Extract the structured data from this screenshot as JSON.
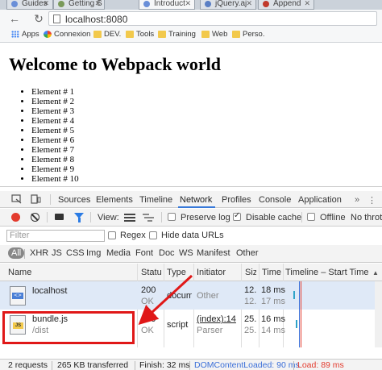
{
  "browser": {
    "tabs": [
      {
        "label": "Guides",
        "color": "#6a8fd8"
      },
      {
        "label": "Getting S",
        "color": "#7a9a5a"
      },
      {
        "label": "Introduct",
        "color": "#6a8fd8"
      },
      {
        "label": "jQuery.aj",
        "color": "#5a7fc4"
      },
      {
        "label": "Append",
        "color": "#c0392b"
      }
    ],
    "url": "localhost:8080",
    "bookmarks": [
      "Apps",
      "Connexion",
      "DEV.",
      "Tools",
      "Training",
      "Web",
      "Perso."
    ]
  },
  "page": {
    "heading": "Welcome to Webpack world",
    "items": [
      "Element # 1",
      "Element # 2",
      "Element # 3",
      "Element # 4",
      "Element # 5",
      "Element # 6",
      "Element # 7",
      "Element # 8",
      "Element # 9",
      "Element # 10"
    ]
  },
  "devtools": {
    "tabs": [
      "Sources",
      "Elements",
      "Timeline",
      "Network",
      "Profiles",
      "Console",
      "Application"
    ],
    "active_tab": "Network",
    "toolbar": {
      "view_label": "View:",
      "preserve_log": "Preserve log",
      "disable_cache": "Disable cache",
      "offline": "Offline",
      "throttle": "No throttling"
    },
    "filter": {
      "placeholder": "Filter",
      "regex": "Regex",
      "hide_data_urls": "Hide data URLs"
    },
    "types": [
      "All",
      "XHR",
      "JS",
      "CSS",
      "Img",
      "Media",
      "Font",
      "Doc",
      "WS",
      "Manifest",
      "Other"
    ],
    "columns": [
      "Name",
      "Status",
      "Type",
      "Initiator",
      "Size",
      "Time",
      "Timeline – Start Time"
    ],
    "rows": [
      {
        "name": "localhost",
        "path": "",
        "status": "200",
        "status_text": "OK",
        "type": "document",
        "initiator": "Other",
        "initiator_sub": "",
        "size": "12...",
        "size_sub": "12...",
        "time": "18 ms",
        "time_sub": "17 ms"
      },
      {
        "name": "bundle.js",
        "path": "/dist",
        "status": "200",
        "status_text": "OK",
        "type": "script",
        "initiator": "(index):14",
        "initiator_sub": "Parser",
        "size": "25...",
        "size_sub": "25...",
        "time": "16 ms",
        "time_sub": "14 ms"
      }
    ],
    "status_bar": {
      "requests": "2 requests",
      "transferred": "265 KB transferred",
      "finish": "Finish: 32 ms",
      "dcl": "DOMContentLoaded: 90 ms",
      "load": "Load: 89 ms"
    },
    "colors": {
      "accent": "#3879d9",
      "record": "#e33b2e",
      "highlight": "#e01818",
      "dcl": "#3b6fd8",
      "load": "#e33b2e"
    }
  }
}
